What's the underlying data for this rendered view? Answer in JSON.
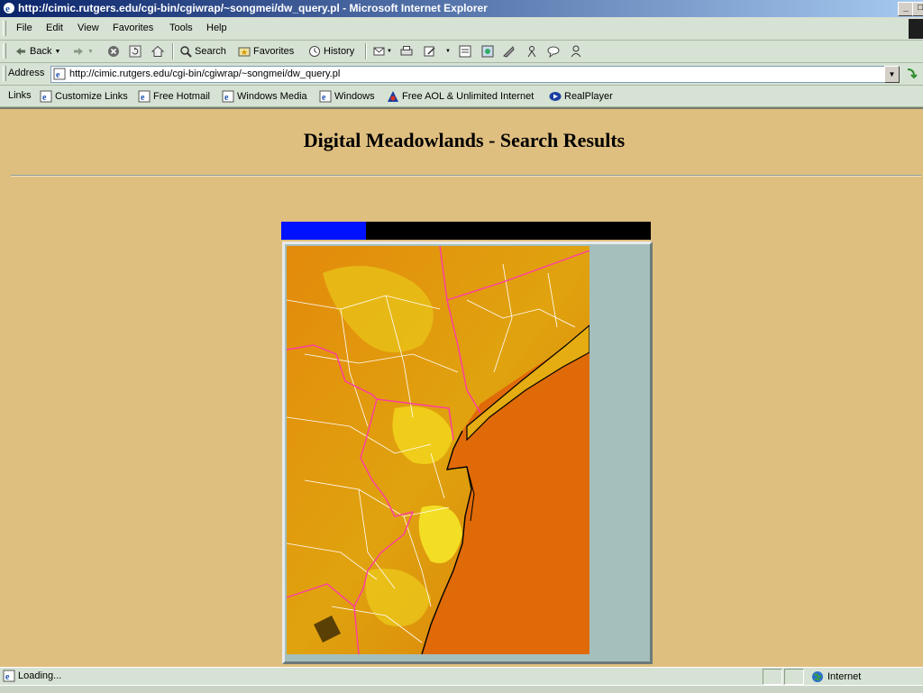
{
  "window": {
    "title": "http://cimic.rutgers.edu/cgi-bin/cgiwrap/~songmei/dw_query.pl - Microsoft Internet Explorer"
  },
  "menu": [
    "File",
    "Edit",
    "View",
    "Favorites",
    "Tools",
    "Help"
  ],
  "toolbar": {
    "back": "Back",
    "search": "Search",
    "favorites": "Favorites",
    "history": "History"
  },
  "address": {
    "label": "Address",
    "url": "http://cimic.rutgers.edu/cgi-bin/cgiwrap/~songmei/dw_query.pl"
  },
  "links": {
    "label": "Links",
    "items": [
      "Customize Links",
      "Free Hotmail",
      "Windows Media",
      "Windows",
      "Free AOL & Unlimited Internet",
      "RealPlayer"
    ]
  },
  "page": {
    "title": "Digital Meadowlands - Search Results",
    "progress_fraction": 0.23
  },
  "status": {
    "text": "Loading...",
    "zone": "Internet"
  },
  "colors": {
    "page_background": "#dfbf80",
    "progress_fill": "#0011ff",
    "map_frame": "#a5bfbd"
  }
}
